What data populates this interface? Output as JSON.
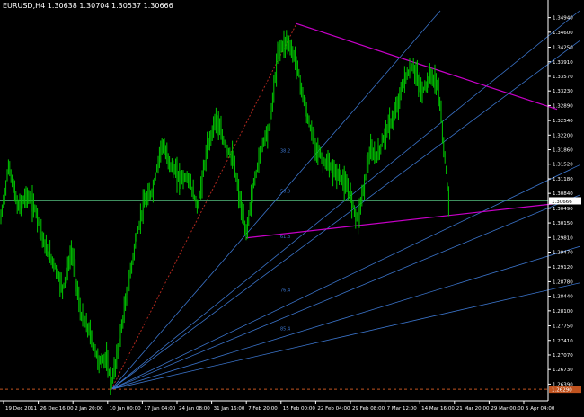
{
  "window": {
    "title": "EURUSD,H4  1.30638 1.30704 1.30537 1.30666"
  },
  "colors": {
    "background": "#000000",
    "candles": "#00c800",
    "axis": "#ffffff",
    "fan_lines": "#3a73c9",
    "trend_lines": "#c800c8",
    "bid_line": "#3f8f5f",
    "low_line": "#c0531f",
    "price_label_bg": "#ffffff"
  },
  "chart_data": {
    "type": "candlestick",
    "symbol": "EURUSD",
    "timeframe": "H4",
    "ohlc_header": {
      "open": 1.30638,
      "high": 1.30704,
      "low": 1.30537,
      "close": 1.30666
    },
    "ylim": [
      1.26,
      1.351
    ],
    "y_ticks": [
      "1.34940",
      "1.34600",
      "1.34250",
      "1.33910",
      "1.33570",
      "1.33230",
      "1.32890",
      "1.32540",
      "1.32200",
      "1.31860",
      "1.31520",
      "1.31180",
      "1.30840",
      "1.30490",
      "1.30150",
      "1.29810",
      "1.29470",
      "1.29120",
      "1.28780",
      "1.28440",
      "1.28100",
      "1.27750",
      "1.27410",
      "1.27070",
      "1.26730",
      "1.26390"
    ],
    "x_ticks": [
      "19 Dec 2011",
      "26 Dec 16:00",
      "2 Jan 20:00",
      "10 Jan 00:00",
      "17 Jan 04:00",
      "24 Jan 08:00",
      "31 Jan 16:00",
      "7 Feb 20:00",
      "15 Feb 00:00",
      "22 Feb 04:00",
      "29 Feb 08:00",
      "7 Mar 12:00",
      "14 Mar 16:00",
      "21 Mar 20:00",
      "29 Mar 00:00",
      "5 Apr 04:00"
    ],
    "current_price": {
      "value": 1.30666,
      "label": "1.30666"
    },
    "low_price": {
      "value": 1.2627,
      "label": "1.26290"
    },
    "fib_fan_levels": [
      "38.2",
      "50.0",
      "61.8",
      "76.4",
      "85.4"
    ],
    "price_path": [
      [
        0,
        1.301
      ],
      [
        10,
        1.315
      ],
      [
        20,
        1.305
      ],
      [
        30,
        1.308
      ],
      [
        40,
        1.3045
      ],
      [
        50,
        1.296
      ],
      [
        60,
        1.292
      ],
      [
        70,
        1.286
      ],
      [
        80,
        1.295
      ],
      [
        90,
        1.28
      ],
      [
        100,
        1.276
      ],
      [
        110,
        1.269
      ],
      [
        118,
        1.27
      ],
      [
        124,
        1.264
      ],
      [
        130,
        1.27
      ],
      [
        140,
        1.283
      ],
      [
        150,
        1.296
      ],
      [
        160,
        1.306
      ],
      [
        170,
        1.309
      ],
      [
        180,
        1.32
      ],
      [
        190,
        1.315
      ],
      [
        200,
        1.312
      ],
      [
        210,
        1.312
      ],
      [
        220,
        1.305
      ],
      [
        230,
        1.318
      ],
      [
        240,
        1.326
      ],
      [
        250,
        1.32
      ],
      [
        260,
        1.316
      ],
      [
        266,
        1.308
      ],
      [
        274,
        1.299
      ],
      [
        282,
        1.31
      ],
      [
        292,
        1.32
      ],
      [
        300,
        1.324
      ],
      [
        310,
        1.342
      ],
      [
        320,
        1.344
      ],
      [
        330,
        1.339
      ],
      [
        340,
        1.328
      ],
      [
        350,
        1.32
      ],
      [
        360,
        1.316
      ],
      [
        370,
        1.314
      ],
      [
        380,
        1.312
      ],
      [
        390,
        1.308
      ],
      [
        398,
        1.302
      ],
      [
        405,
        1.31
      ],
      [
        412,
        1.318
      ],
      [
        420,
        1.317
      ],
      [
        430,
        1.323
      ],
      [
        440,
        1.327
      ],
      [
        450,
        1.335
      ],
      [
        460,
        1.338
      ],
      [
        470,
        1.332
      ],
      [
        480,
        1.336
      ],
      [
        488,
        1.333
      ],
      [
        492,
        1.324
      ],
      [
        496,
        1.315
      ],
      [
        500,
        1.305
      ]
    ],
    "drawings": {
      "fan_origin": {
        "x": 124,
        "price": 1.2627
      },
      "fan_targets": [
        {
          "x": 490,
          "price": 1.351
        },
        {
          "x": 645,
          "price": 1.351
        },
        {
          "x": 645,
          "price": 1.344
        },
        {
          "x": 645,
          "price": 1.315
        },
        {
          "x": 645,
          "price": 1.308
        },
        {
          "x": 645,
          "price": 1.296
        },
        {
          "x": 645,
          "price": 1.2875
        }
      ],
      "fan_labels": [
        {
          "text": "38.2",
          "x": 312,
          "price": 1.318
        },
        {
          "text": "50.0",
          "x": 312,
          "price": 1.3085
        },
        {
          "text": "61.8",
          "x": 312,
          "price": 1.298
        },
        {
          "text": "76.4",
          "x": 312,
          "price": 1.2855
        },
        {
          "text": "85.4",
          "x": 312,
          "price": 1.2765
        }
      ],
      "red_diagonal": {
        "from": {
          "x": 124,
          "price": 1.2627
        },
        "to": {
          "x": 330,
          "price": 1.348
        }
      },
      "upper_trend": {
        "from": {
          "x": 330,
          "price": 1.348
        },
        "to": {
          "x": 620,
          "price": 1.328
        }
      },
      "lower_trend": {
        "from": {
          "x": 274,
          "price": 1.298
        },
        "to": {
          "x": 618,
          "price": 1.306
        }
      }
    }
  }
}
